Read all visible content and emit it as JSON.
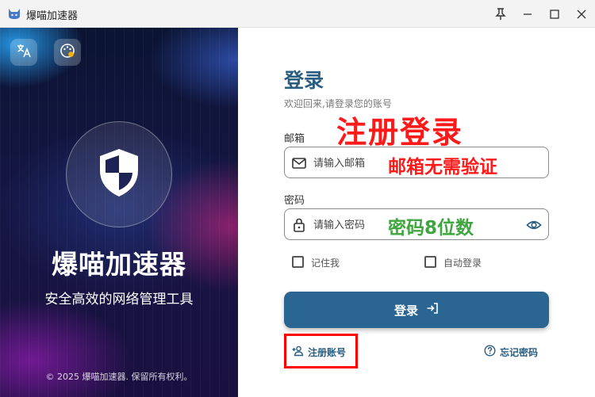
{
  "window": {
    "title": "爆喵加速器"
  },
  "sidebar": {
    "brand_title": "爆喵加速器",
    "brand_subtitle": "安全高效的网络管理工具",
    "copyright": "© 2025 爆喵加速器. 保留所有权利。",
    "translate_icon": "translate-icon",
    "theme_icon": "palette-icon",
    "shield_icon": "shield-icon"
  },
  "login": {
    "title": "登录",
    "subtitle": "欢迎回来,请登录您的账号",
    "email_label": "邮箱",
    "email_placeholder": "请输入邮箱",
    "email_value": "",
    "password_label": "密码",
    "password_placeholder": "请输入密码",
    "password_value": "",
    "remember_label": "记住我",
    "remember_checked": false,
    "auto_login_label": "自动登录",
    "auto_login_checked": false,
    "submit_label": "登录",
    "register_label": "注册账号",
    "forgot_label": "忘记密码"
  },
  "annotations": {
    "main": "注册登录",
    "email_note": "邮箱无需验证",
    "password_note": "密码8位数"
  },
  "colors": {
    "accent": "#2b6591",
    "title": "#2a5d82",
    "annotation_red": "#ff1a1a",
    "annotation_green": "#3fa63f"
  }
}
